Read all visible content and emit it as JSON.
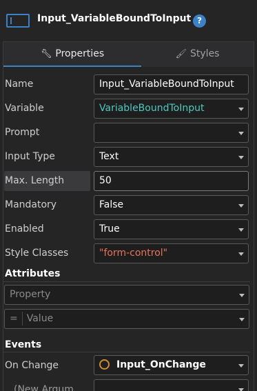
{
  "header": {
    "title": "Input_VariableBoundToInput",
    "help_label": "?"
  },
  "tabs": [
    {
      "label": "Properties",
      "icon": "wrench-icon"
    },
    {
      "label": "Styles",
      "icon": "brush-icon"
    }
  ],
  "properties": {
    "name": {
      "label": "Name",
      "value": "Input_VariableBoundToInput"
    },
    "variable": {
      "label": "Variable",
      "value": "VariableBoundToInput"
    },
    "prompt": {
      "label": "Prompt",
      "value": ""
    },
    "input_type": {
      "label": "Input Type",
      "value": "Text"
    },
    "max_length": {
      "label": "Max. Length",
      "value": "50"
    },
    "mandatory": {
      "label": "Mandatory",
      "value": "False"
    },
    "enabled": {
      "label": "Enabled",
      "value": "True"
    },
    "style_classes": {
      "label": "Style Classes",
      "value": "\"form-control\""
    }
  },
  "attributes": {
    "section_label": "Attributes",
    "property_placeholder": "Property",
    "value_placeholder": "Value",
    "eq_sign": "="
  },
  "events": {
    "section_label": "Events",
    "on_change": {
      "label": "On Change",
      "value": "Input_OnChange"
    },
    "new_argument_label": "(New Argum"
  },
  "colors": {
    "accent": "#3b82c9",
    "variable": "#4ec9c0",
    "string_literal": "#e8735a",
    "action_icon": "#d48a2e"
  }
}
